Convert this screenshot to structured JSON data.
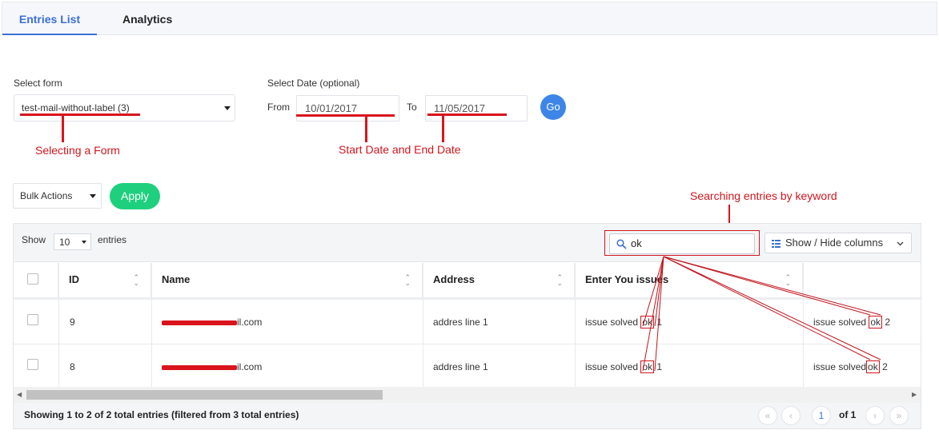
{
  "tabs": [
    {
      "label": "Entries List",
      "active": true
    },
    {
      "label": "Analytics",
      "active": false
    }
  ],
  "filters": {
    "select_form_label": "Select form",
    "select_form_value": "test-mail-without-label (3)",
    "select_date_label": "Select Date (optional)",
    "from_label": "From",
    "from_value": "10/01/2017",
    "to_label": "To",
    "to_value": "11/05/2017",
    "go_label": "Go"
  },
  "annotations": {
    "form": "Selecting a Form",
    "dates": "Start Date and End Date",
    "search": "Searching entries by keyword"
  },
  "bulk": {
    "select_value": "Bulk Actions",
    "apply_label": "Apply"
  },
  "table_controls": {
    "show_label": "Show",
    "show_value": "10",
    "entries_label": "entries",
    "search_value": "ok",
    "show_hide_label": "Show / Hide columns"
  },
  "table": {
    "columns": [
      "ID",
      "Name",
      "Address",
      "Enter You issues"
    ],
    "rows": [
      {
        "id": "9",
        "name": "il.com",
        "address": "addres line 1",
        "issue_pre": "issue solved ",
        "issue_hl": "ok",
        "issue_post": " 1",
        "extra_pre": "issue solved ",
        "extra_hl": "ok",
        "extra_post": " 2"
      },
      {
        "id": "8",
        "name": "il.com",
        "address": "addres line 1",
        "issue_pre": "issue solved ",
        "issue_hl": "ok",
        "issue_post": " 1",
        "extra_pre": "issue solved",
        "extra_hl": "ok",
        "extra_post": " 2"
      }
    ]
  },
  "footer": {
    "summary": "Showing 1 to 2 of 2 total entries (filtered from 3 total entries)",
    "current_page": "1",
    "of_pages": "of 1"
  },
  "colors": {
    "accent": "#3b6fd6",
    "apply": "#1ed07e",
    "go": "#3d86e8",
    "annotation": "#d0161e"
  },
  "icons": [
    "chevron-down-icon",
    "search-icon",
    "columns-icon",
    "sort-icon",
    "first-page-icon",
    "prev-page-icon",
    "next-page-icon",
    "last-page-icon"
  ]
}
